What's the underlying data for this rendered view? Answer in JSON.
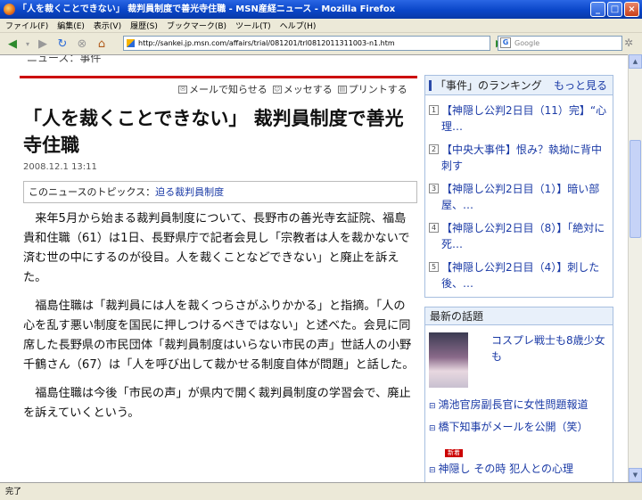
{
  "window": {
    "title": "「人を裁くことできない」 裁判員制度で善光寺住職 - MSN産経ニュース - Mozilla Firefox",
    "controls": [
      "_",
      "□",
      "×"
    ]
  },
  "menu": [
    "ファイル(F)",
    "編集(E)",
    "表示(V)",
    "履歴(S)",
    "ブックマーク(B)",
    "ツール(T)",
    "ヘルプ(H)"
  ],
  "nav": {
    "url": "http://sankei.jp.msn.com/affairs/trial/081201/trl0812011311003-n1.htm",
    "search_placeholder": "Google",
    "search_engine_letter": "G"
  },
  "article": {
    "cut_header": "ニュース：事件",
    "actions": [
      {
        "label": "メールで知らせる",
        "icon": "mail-icon"
      },
      {
        "label": "メッセする",
        "icon": "messenger-icon"
      },
      {
        "label": "プリントする",
        "icon": "print-icon"
      }
    ],
    "headline": "「人を裁くことできない」 裁判員制度で善光寺住職",
    "date": "2008.12.1 13:11",
    "topics_label": "このニュースのトピックス：",
    "topics_link": "迫る裁判員制度",
    "paragraphs": [
      "来年5月から始まる裁判員制度について、長野市の善光寺玄証院、福島貴和住職（61）は1日、長野県庁で記者会見し「宗教者は人を裁かないで済む世の中にするのが役目。人を裁くことなどできない」と廃止を訴えた。",
      "福島住職は「裁判員には人を裁くつらさがふりかかる」と指摘。「人の心を乱す悪い制度を国民に押しつけるべきではない」と述べた。会見に同席した長野県の市民団体「裁判員制度はいらない市民の声」世話人の小野千鶴さん（67）は「人を呼び出して裁かせる制度自体が問題」と話した。",
      "福島住職は今後「市民の声」が県内で開く裁判員制度の学習会で、廃止を訴えていくという。"
    ]
  },
  "ranking": {
    "title": "「事件」のランキング",
    "more": "もっと見る",
    "items": [
      {
        "num": "1",
        "text": "【神隠し公判2日目（11）完】“心理…"
      },
      {
        "num": "2",
        "text": "【中央大事件】恨み？執拗に背中刺す"
      },
      {
        "num": "3",
        "text": "【神隠し公判2日目（1）】暗い部屋、…"
      },
      {
        "num": "4",
        "text": "【神隠し公判2日目（8）】「絶対に死…"
      },
      {
        "num": "5",
        "text": "【神隠し公判2日目（4）】刺した後、…"
      }
    ]
  },
  "latest": {
    "title": "最新の話題",
    "photo_caption": "コスプレ戦士も8歳少女も",
    "items": [
      "鴻池官房副長官に女性問題報道",
      "橋下知事がメールを公開（笑）",
      "神隠し その時 犯人との心理"
    ],
    "new_badge": "新着"
  },
  "status": "完了"
}
